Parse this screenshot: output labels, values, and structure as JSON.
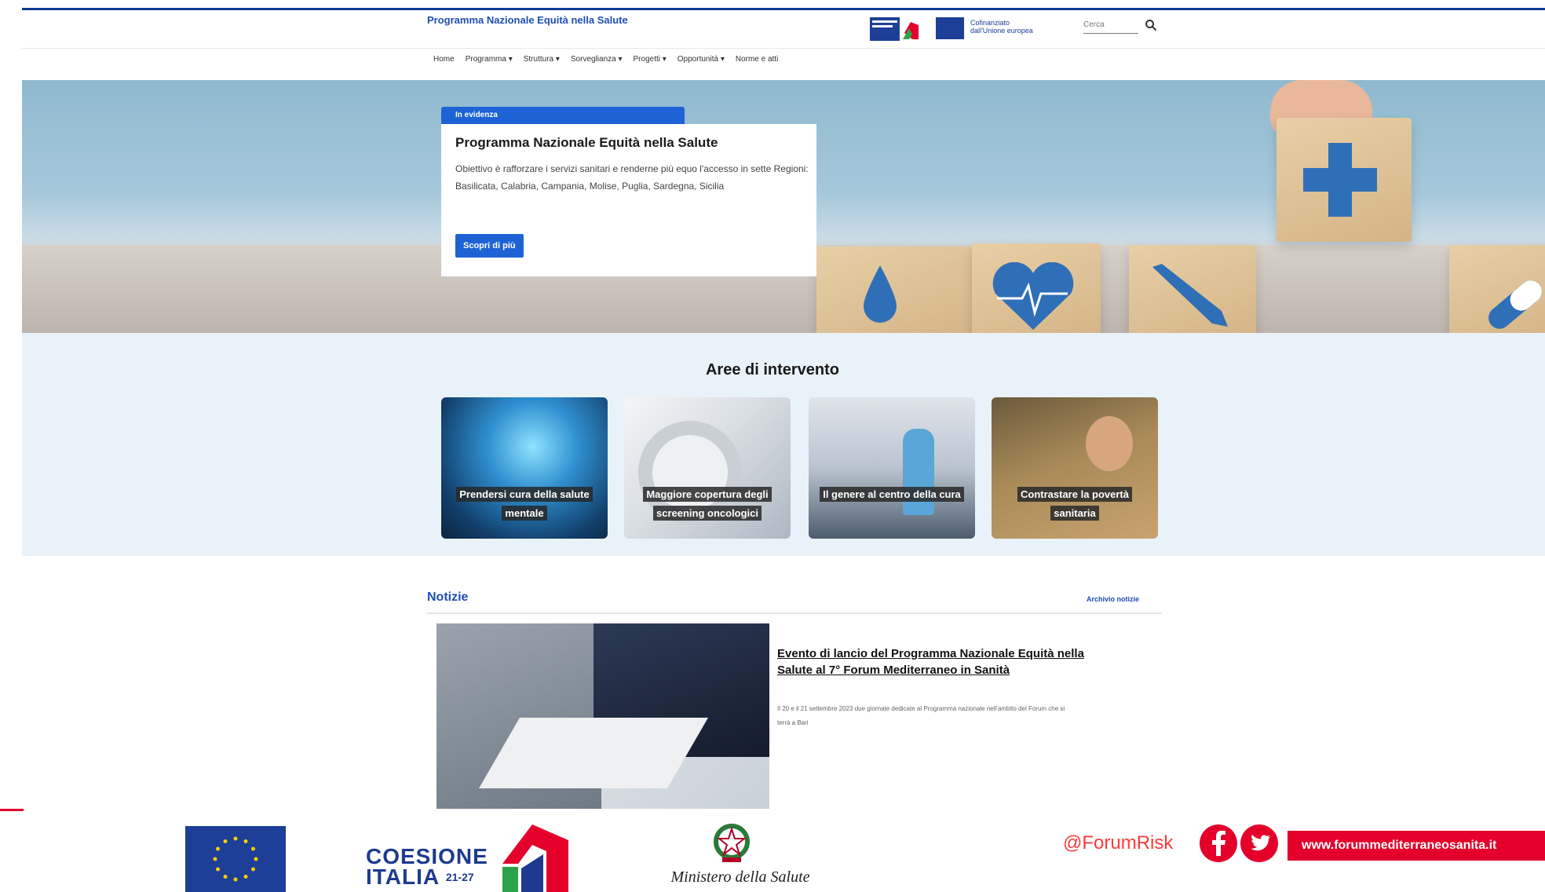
{
  "header": {
    "site_title": "Programma Nazionale Equità nella Salute",
    "eu_cofunded": "Cofinanziato dall'Unione europea",
    "search_placeholder": "Cerca"
  },
  "nav": {
    "items": [
      "Home",
      "Programma ▾",
      "Struttura ▾",
      "Sorveglianza ▾",
      "Progetti ▾",
      "Opportunità ▾",
      "Norme e atti"
    ]
  },
  "hero": {
    "tag": "In evidenza",
    "title": "Programma Nazionale Equità nella Salute",
    "description": "Obiettivo è rafforzare i servizi sanitari e renderne più equo l'accesso in sette Regioni: Basilicata, Calabria, Campania, Molise, Puglia, Sardegna, Sicilia",
    "cta": "Scopri di più"
  },
  "areas": {
    "title": "Aree di intervento",
    "cards": [
      {
        "label": "Prendersi cura della salute mentale"
      },
      {
        "label": "Maggiore copertura degli screening oncologici"
      },
      {
        "label": "Il genere al centro della cura"
      },
      {
        "label": "Contrastare la povertà sanitaria"
      }
    ]
  },
  "news": {
    "title": "Notizie",
    "archive_link": "Archivio notizie",
    "headline": "Evento di lancio del Programma Nazionale Equità nella Salute al 7° Forum Mediterraneo in Sanità",
    "excerpt": "Il 20 e il 21 settembre 2023 due giornate dedicate al Programma nazionale nell'ambito del Forum che si terrà a Bari"
  },
  "footer": {
    "coesione_line1": "COESIONE",
    "coesione_line2": "ITALIA",
    "coesione_years": "21-27",
    "ministero": "Ministero della Salute",
    "forum_handle": "@ForumRisk",
    "forum_url": "www.forummediterraneosanita.it"
  },
  "colors": {
    "primary_blue": "#1d63d6",
    "title_blue": "#1d4fb3",
    "eu_blue": "#1d3f97",
    "forum_red": "#e4002b",
    "section_bg": "#eaf2f9"
  },
  "icons": [
    "search-icon",
    "facebook-icon",
    "twitter-icon",
    "eu-flag-icon",
    "coesione-logo-icon",
    "italian-emblem-icon",
    "medical-cross-icon",
    "heart-icon",
    "drop-icon",
    "thermometer-icon",
    "pill-icon"
  ]
}
